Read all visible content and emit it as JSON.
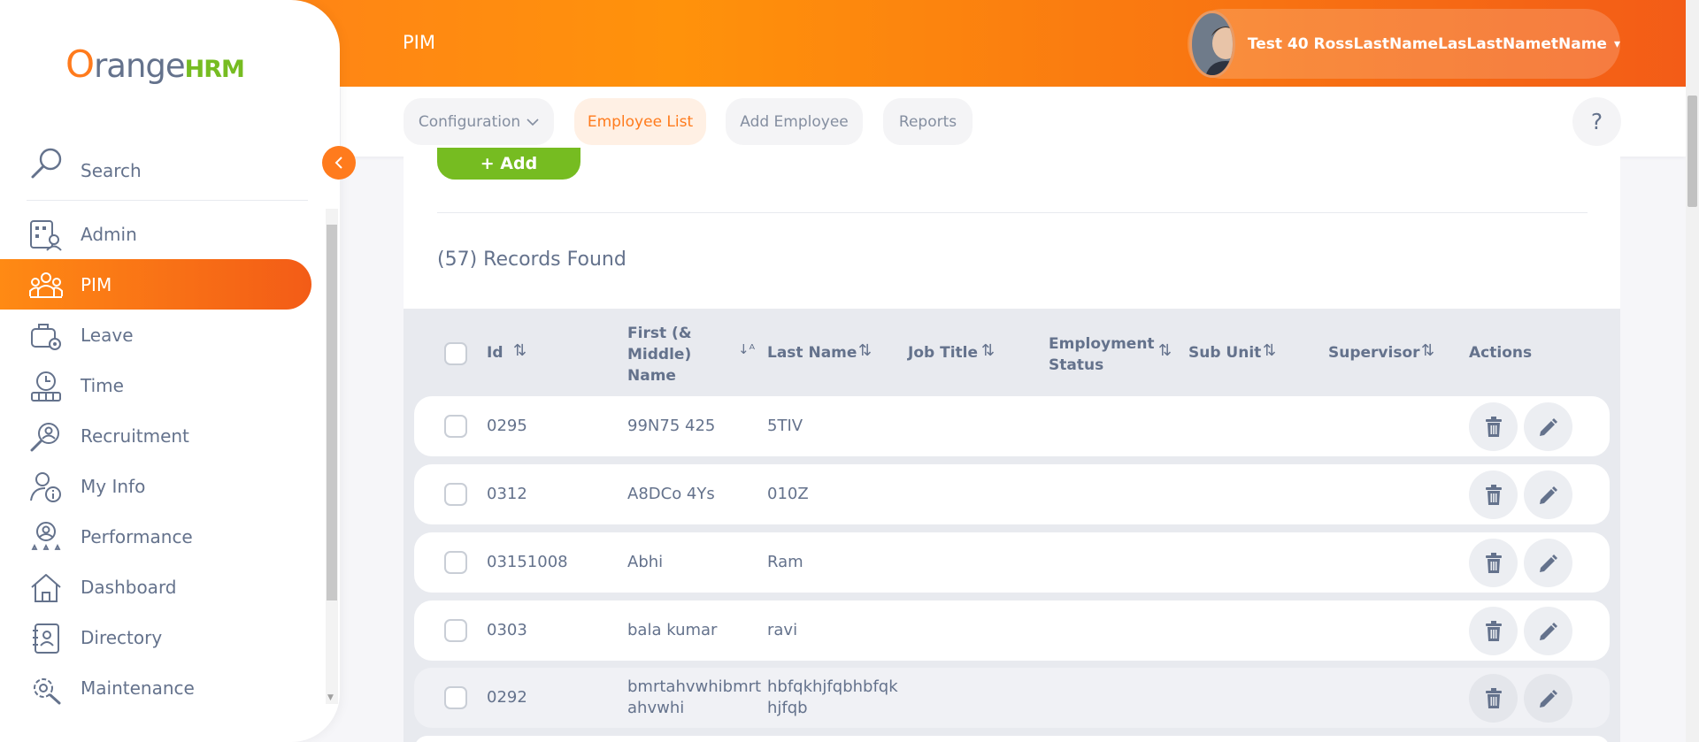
{
  "header": {
    "module_title": "PIM",
    "user_name": "Test 40 RossLastNameLasLastNametName",
    "caret": "▾"
  },
  "subnav": {
    "configuration": "Configuration",
    "employee_list": "Employee List",
    "add_employee": "Add Employee",
    "reports": "Reports",
    "help": "?"
  },
  "main": {
    "add_label": "+ Add",
    "records_found": "(57) Records Found"
  },
  "table": {
    "headers": {
      "id": "Id",
      "first_name_l1": "First (&",
      "first_name_l2": "Middle)",
      "first_name_l3": "Name",
      "last_name": "Last Name",
      "job_title": "Job Title",
      "employment_status_l1": "Employment",
      "employment_status_l2": "Status",
      "sub_unit": "Sub Unit",
      "supervisor": "Supervisor",
      "actions": "Actions"
    },
    "rows": [
      {
        "id": "0295",
        "first": "99N75 425",
        "first2": "",
        "last": "5TIV",
        "last2": ""
      },
      {
        "id": "0312",
        "first": "A8DCo 4Ys",
        "first2": "",
        "last": "010Z",
        "last2": ""
      },
      {
        "id": "03151008",
        "first": "Abhi",
        "first2": "",
        "last": "Ram",
        "last2": ""
      },
      {
        "id": "0303",
        "first": "bala kumar",
        "first2": "",
        "last": "ravi",
        "last2": ""
      },
      {
        "id": "0292",
        "first": "bmrtahvwhibmrt",
        "first2": "ahvwhi",
        "last": "hbfqkhjfqbhbfqk",
        "last2": "hjfqb"
      }
    ]
  },
  "sidebar": {
    "logo_o": "O",
    "logo_range": "range",
    "logo_hrm": "HRM",
    "search": "Search",
    "items": [
      {
        "label": "Admin",
        "icon": "admin-icon"
      },
      {
        "label": "PIM",
        "icon": "pim-icon"
      },
      {
        "label": "Leave",
        "icon": "leave-icon"
      },
      {
        "label": "Time",
        "icon": "time-icon"
      },
      {
        "label": "Recruitment",
        "icon": "recruitment-icon"
      },
      {
        "label": "My Info",
        "icon": "my-info-icon"
      },
      {
        "label": "Performance",
        "icon": "performance-icon"
      },
      {
        "label": "Dashboard",
        "icon": "dashboard-icon"
      },
      {
        "label": "Directory",
        "icon": "directory-icon"
      },
      {
        "label": "Maintenance",
        "icon": "maintenance-icon"
      }
    ]
  },
  "colors": {
    "brand_orange": "#ff7b1d",
    "brand_green": "#76bc21",
    "text_gray": "#64728c"
  }
}
